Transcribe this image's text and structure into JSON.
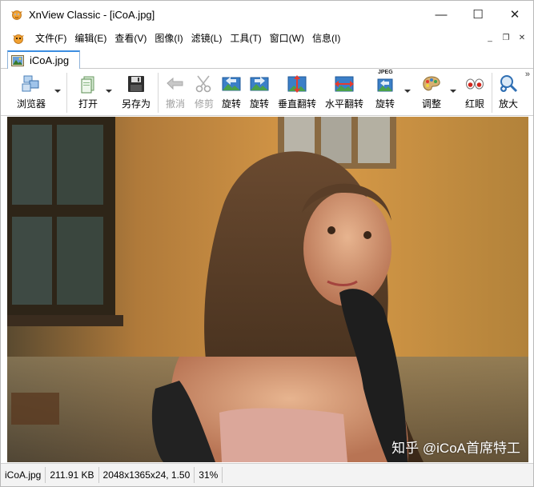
{
  "window": {
    "title": "XnView Classic - [iCoA.jpg]",
    "controls": {
      "minimize": "—",
      "maximize": "☐",
      "close": "✕"
    }
  },
  "menu": {
    "items": [
      "文件(F)",
      "编辑(E)",
      "查看(V)",
      "图像(I)",
      "滤镜(L)",
      "工具(T)",
      "窗口(W)",
      "信息(I)"
    ],
    "mdi": {
      "minimize": "_",
      "restore": "❐",
      "close": "✕"
    }
  },
  "tabs": [
    {
      "label": "iCoA.jpg"
    }
  ],
  "toolbar": {
    "browser": "浏览器",
    "open": "打开",
    "save_as": "另存为",
    "undo": "撤消",
    "crop": "修剪",
    "rotate_left": "旋转",
    "rotate_right": "旋转",
    "flip_vertical": "垂直翻转",
    "flip_horizontal": "水平翻转",
    "rotate_jpeg": "旋转",
    "rotate_jpeg_badge": "JPEG",
    "adjust": "调整",
    "red_eye": "红眼",
    "zoom": "放大",
    "more": "»"
  },
  "viewport": {
    "watermark": "知乎 @iCoA首席特工"
  },
  "status": {
    "filename": "iCoA.jpg",
    "filesize": "211.91 KB",
    "dimensions": "2048x1365x24, 1.50",
    "zoom": "31%"
  },
  "colors": {
    "tab_accent": "#3b8de0",
    "toolbar_icon_blue": "#2f7fd1",
    "toolbar_icon_green": "#3fa34d"
  }
}
